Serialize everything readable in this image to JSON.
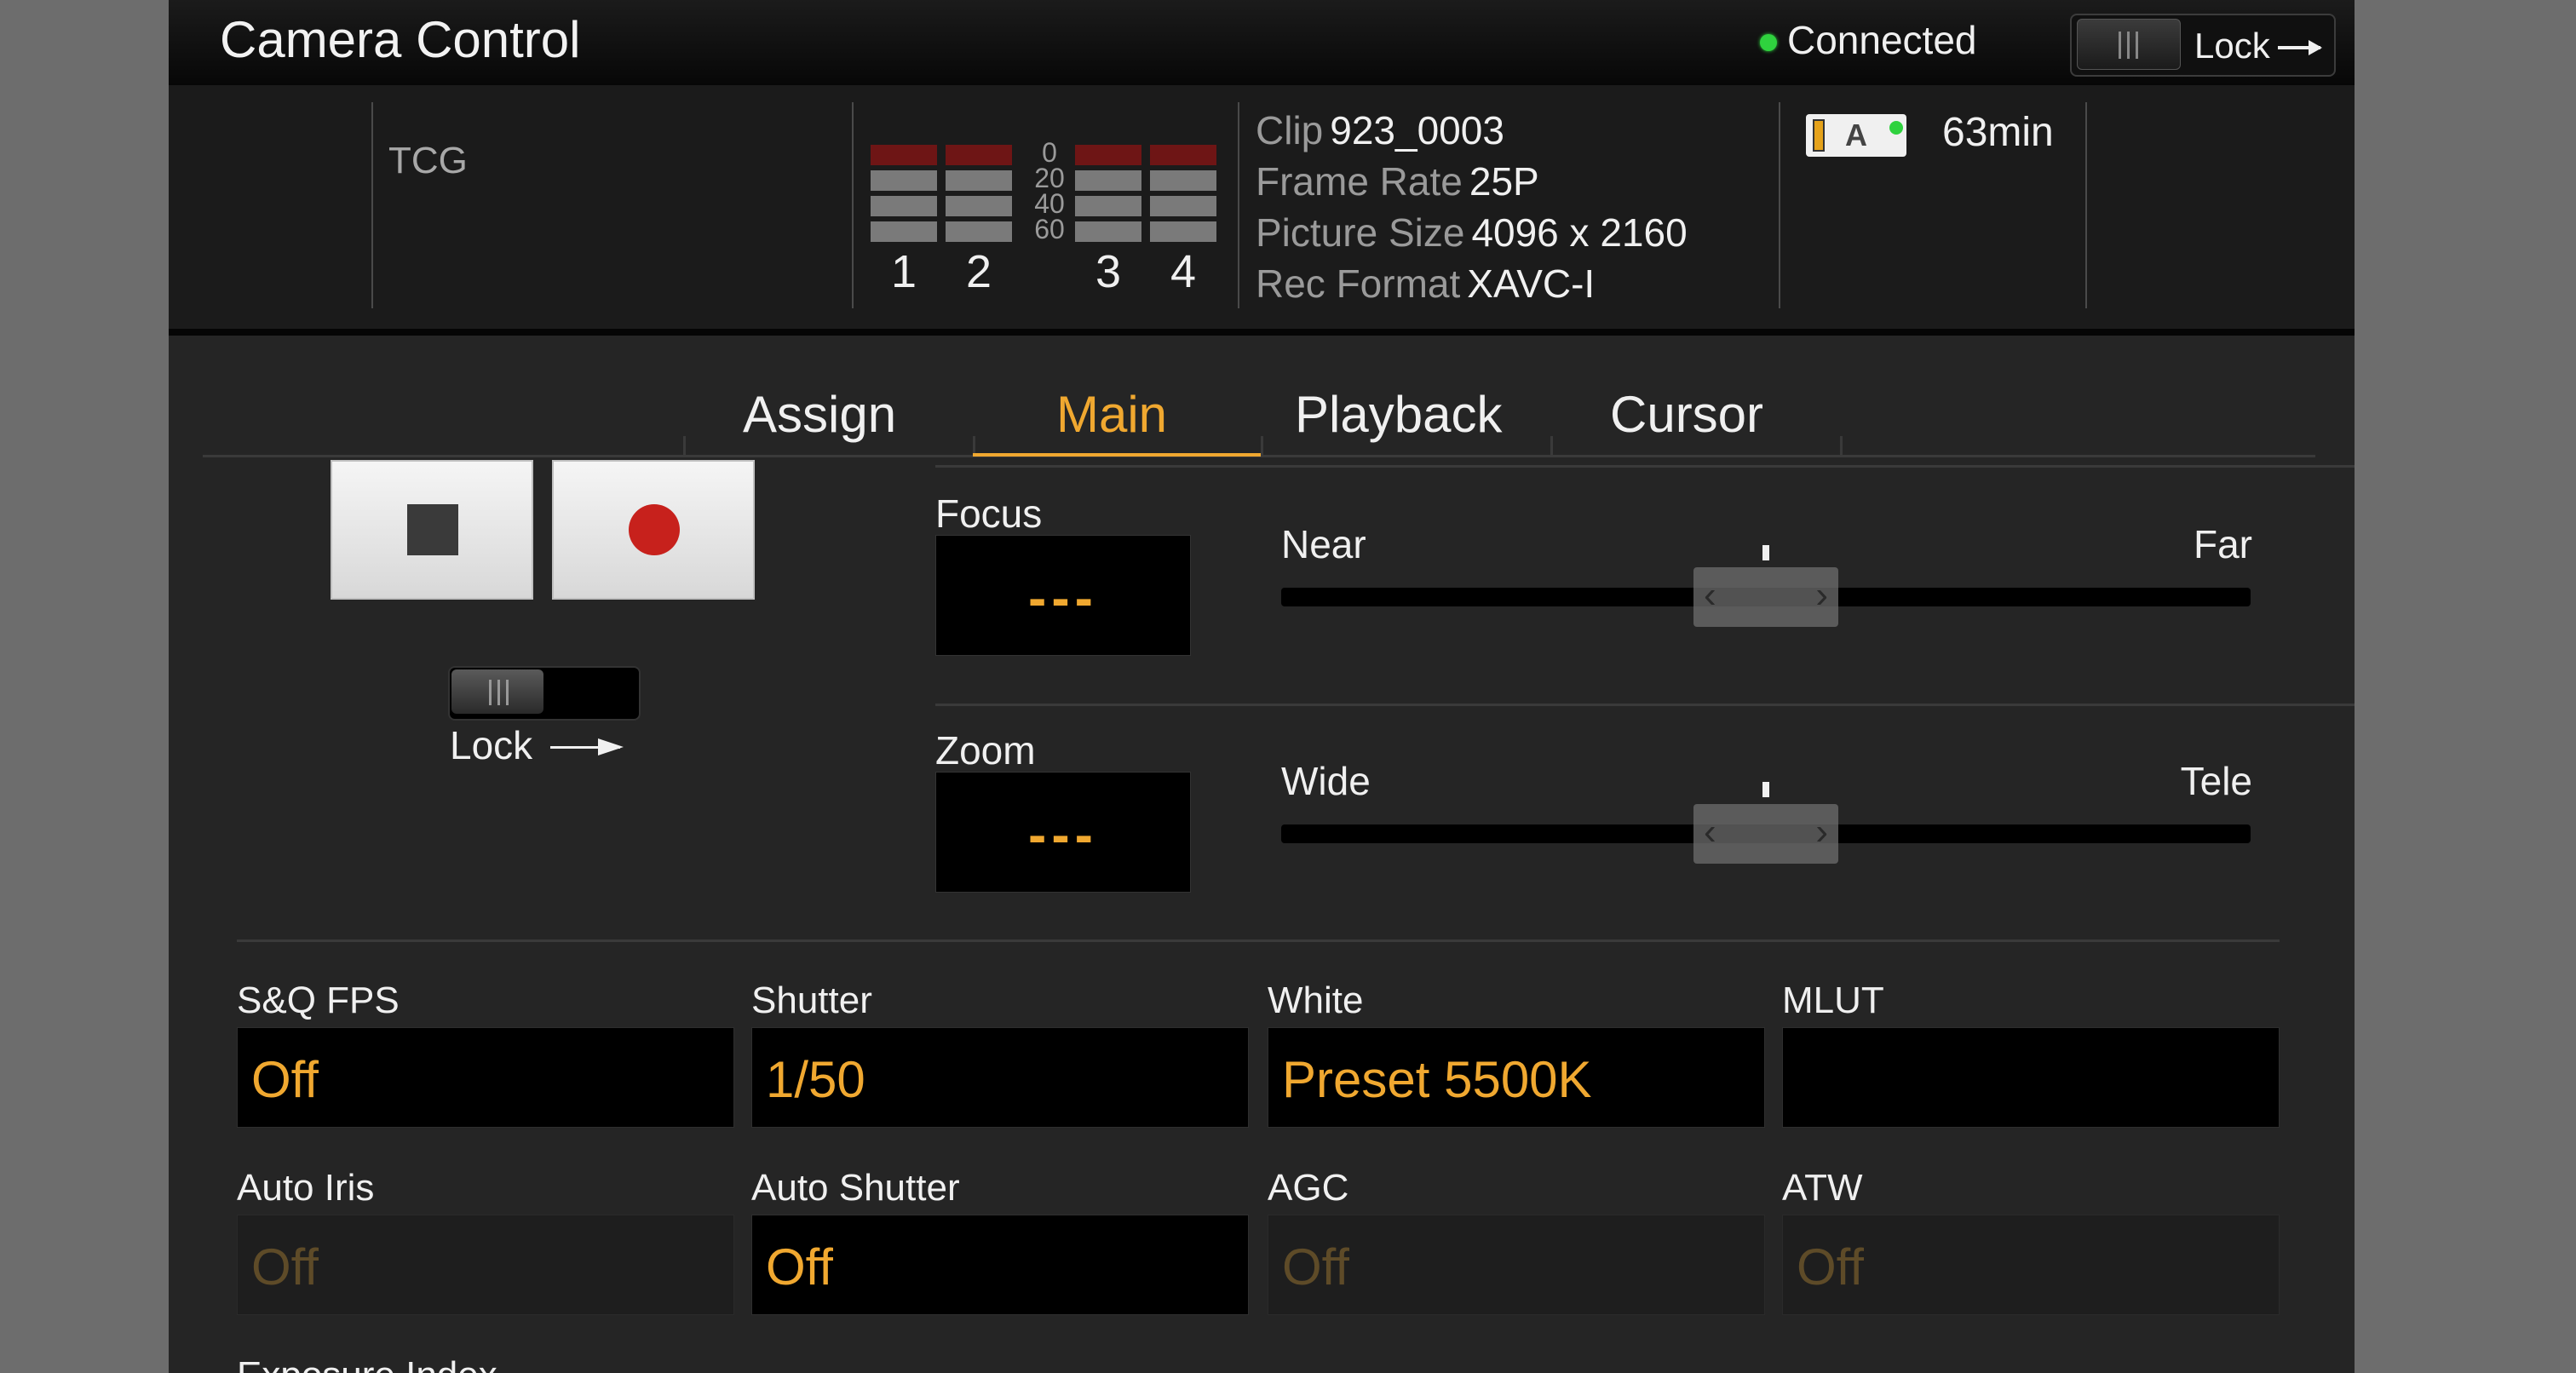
{
  "header": {
    "title": "Camera Control",
    "status": "Connected",
    "lock_label": "Lock"
  },
  "status_panel": {
    "tcg_label": "TCG",
    "audio_scale": [
      "0",
      "20",
      "40",
      "60"
    ],
    "audio_channels": [
      "1",
      "2",
      "3",
      "4"
    ],
    "clip_label": "Clip",
    "clip_value": "923_0003",
    "frame_rate_label": "Frame Rate",
    "frame_rate_value": "25P",
    "picture_size_label": "Picture Size",
    "picture_size_value": "4096 x 2160",
    "rec_format_label": "Rec Format",
    "rec_format_value": "XAVC-I",
    "media_slot": "A",
    "remaining": "63min"
  },
  "tabs": [
    "Assign",
    "Main",
    "Playback",
    "Cursor"
  ],
  "active_tab": "Main",
  "record": {
    "lock_label": "Lock"
  },
  "focus": {
    "label": "Focus",
    "value": "---",
    "min_label": "Near",
    "max_label": "Far",
    "position": 0.5
  },
  "zoom": {
    "label": "Zoom",
    "value": "---",
    "min_label": "Wide",
    "max_label": "Tele",
    "position": 0.5
  },
  "params": {
    "sq_fps": {
      "label": "S&Q FPS",
      "value": "Off"
    },
    "shutter": {
      "label": "Shutter",
      "value": "1/50"
    },
    "white": {
      "label": "White",
      "value": "Preset 5500K"
    },
    "mlut": {
      "label": "MLUT",
      "value": ""
    },
    "auto_iris": {
      "label": "Auto Iris",
      "value": "Off"
    },
    "auto_shutter": {
      "label": "Auto Shutter",
      "value": "Off"
    },
    "agc": {
      "label": "AGC",
      "value": "Off"
    },
    "atw": {
      "label": "ATW",
      "value": "Off"
    },
    "exposure_index": {
      "label": "Exposure Index"
    }
  },
  "colors": {
    "accent": "#f0a830",
    "record": "#c7211c",
    "connected": "#2fd23e"
  }
}
